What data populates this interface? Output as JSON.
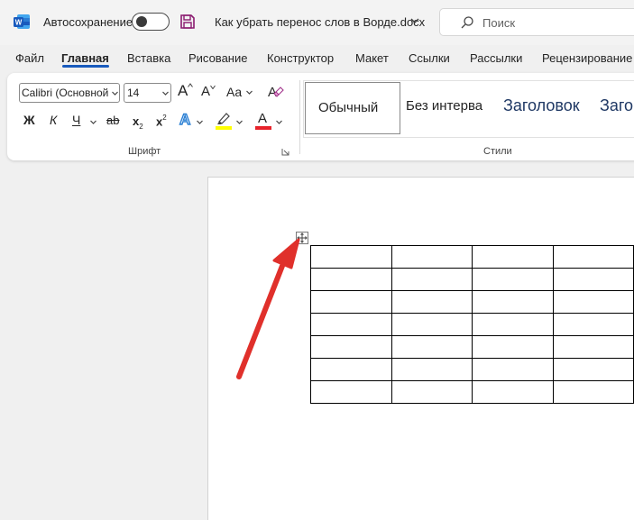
{
  "titlebar": {
    "autosave_label": "Автосохранение",
    "autosave_on": false,
    "document_title": "Как убрать перенос слов в Ворде.docx",
    "search_placeholder": "Поиск"
  },
  "tabs": [
    {
      "label": "Файл",
      "active": false
    },
    {
      "label": "Главная",
      "active": true
    },
    {
      "label": "Вставка",
      "active": false
    },
    {
      "label": "Рисование",
      "active": false
    },
    {
      "label": "Конструктор",
      "active": false
    },
    {
      "label": "Макет",
      "active": false
    },
    {
      "label": "Ссылки",
      "active": false
    },
    {
      "label": "Рассылки",
      "active": false
    },
    {
      "label": "Рецензирование",
      "active": false
    }
  ],
  "font_group": {
    "font_name": "Calibri (Основной",
    "font_size": "14",
    "grow_label": "A",
    "shrink_label": "A",
    "case_label": "Aa",
    "bold_label": "Ж",
    "italic_label": "К",
    "underline_label": "Ч",
    "strike_label": "ab",
    "subscript_label": "x",
    "subscript_mark": "2",
    "superscript_label": "x",
    "superscript_mark": "2",
    "text_effects_label": "A",
    "font_color_label": "A",
    "group_label": "Шрифт",
    "highlight_color": "#ffff00",
    "font_color": "#e8232b"
  },
  "styles_group": {
    "items": [
      {
        "label": "Обычный",
        "selected": true
      },
      {
        "label": "Без интерва",
        "selected": false
      },
      {
        "label": "Заголовок",
        "selected": false
      },
      {
        "label": "Заго",
        "selected": false
      }
    ],
    "group_label": "Стили"
  },
  "document": {
    "table": {
      "rows": 7,
      "visible_columns": 4
    },
    "arrow_color": "#e0302b"
  }
}
